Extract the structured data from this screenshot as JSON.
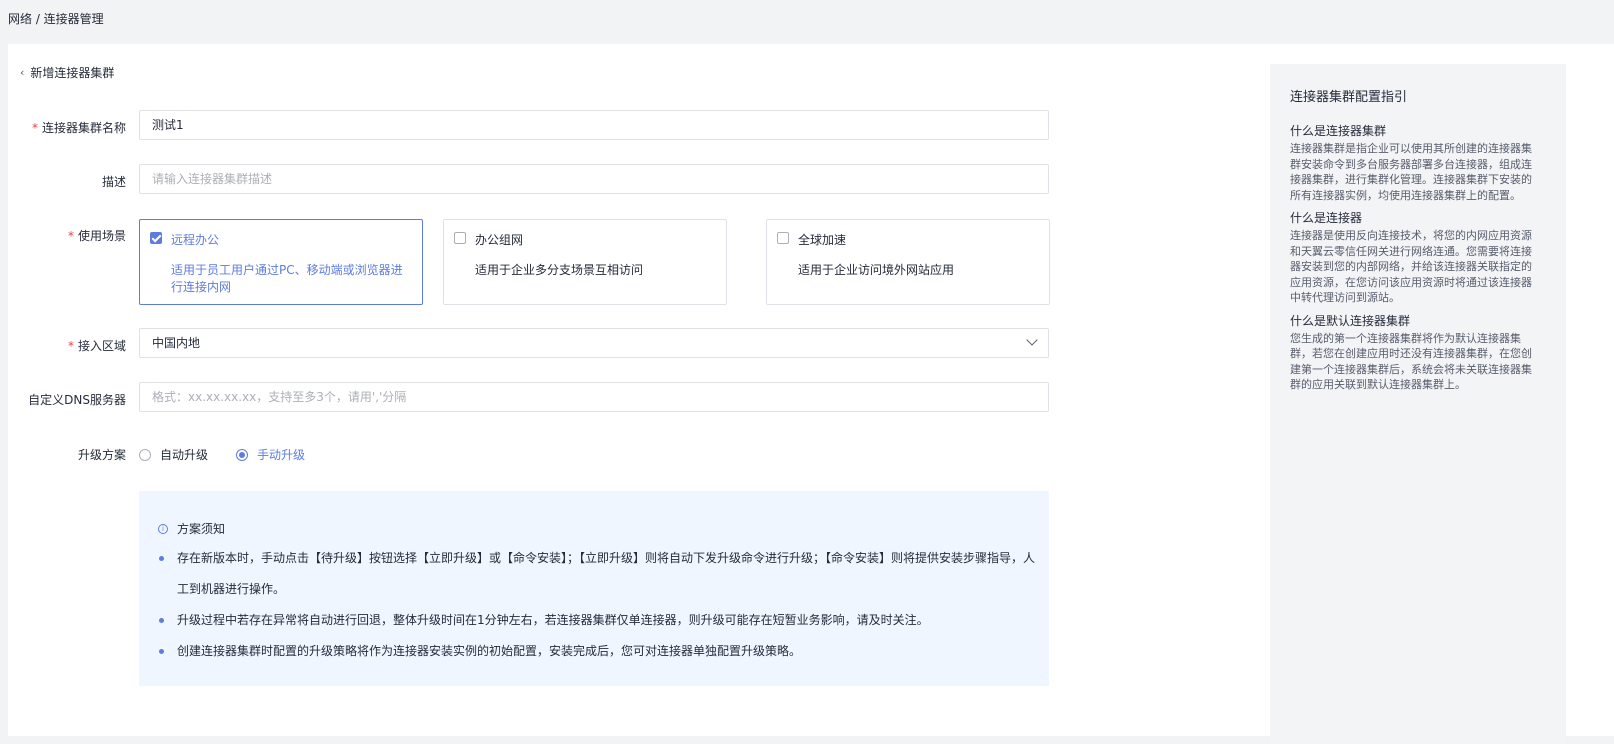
{
  "breadcrumb": "网络 / 连接器管理",
  "back": {
    "label": "新增连接器集群"
  },
  "form": {
    "name": {
      "label": "连接器集群名称",
      "value": "测试1"
    },
    "description": {
      "label": "描述",
      "placeholder": "请输入连接器集群描述"
    },
    "scene": {
      "label": "使用场景",
      "options": [
        {
          "title": "远程办公",
          "desc": "适用于员工用户通过PC、移动端或浏览器进行连接内网",
          "checked": true
        },
        {
          "title": "办公组网",
          "desc": "适用于企业多分支场景互相访问",
          "checked": false
        },
        {
          "title": "全球加速",
          "desc": "适用于企业访问境外网站应用",
          "checked": false
        }
      ]
    },
    "region": {
      "label": "接入区域",
      "value": "中国内地"
    },
    "dns": {
      "label": "自定义DNS服务器",
      "placeholder": "格式：xx.xx.xx.xx，支持至多3个，请用','分隔"
    },
    "upgrade": {
      "label": "升级方案",
      "options": [
        {
          "label": "自动升级",
          "checked": false
        },
        {
          "label": "手动升级",
          "checked": true
        }
      ]
    }
  },
  "notice": {
    "title": "方案须知",
    "items": [
      "存在新版本时，手动点击【待升级】按钮选择【立即升级】或【命令安装】；【立即升级】则将自动下发升级命令进行升级；【命令安装】则将提供安装步骤指导，人工到机器进行操作。",
      "升级过程中若存在异常将自动进行回退，整体升级时间在1分钟左右，若连接器集群仅单连接器，则升级可能存在短暂业务影响，请及时关注。",
      "创建连接器集群时配置的升级策略将作为连接器安装实例的初始配置，安装完成后，您可对连接器单独配置升级策略。"
    ]
  },
  "guide": {
    "title": "连接器集群配置指引",
    "sections": [
      {
        "title": "什么是连接器集群",
        "text": "连接器集群是指企业可以使用其所创建的连接器集群安装命令到多台服务器部署多台连接器，组成连接器集群，进行集群化管理。连接器集群下安装的所有连接器实例，均使用连接器集群上的配置。"
      },
      {
        "title": "什么是连接器",
        "text": "连接器是使用反向连接技术，将您的内网应用资源和天翼云零信任网关进行网络连通。您需要将连接器安装到您的内部网络，并给该连接器关联指定的应用资源，在您访问该应用资源时将通过该连接器中转代理访问到源站。"
      },
      {
        "title": "什么是默认连接器集群",
        "text": "您生成的第一个连接器集群将作为默认连接器集群，若您在创建应用时还没有连接器集群，在您创建第一个连接器集群后，系统会将未关联连接器集群的应用关联到默认连接器集群上。"
      }
    ]
  }
}
